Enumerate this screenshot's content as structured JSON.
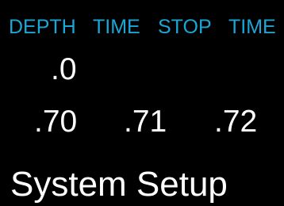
{
  "header": {
    "depth_label": "DEPTH",
    "time_label_1": "TIME",
    "stop_label": "STOP",
    "time_label_2": "TIME"
  },
  "readings": {
    "depth_value": ".0",
    "value_1": ".70",
    "value_2": ".71",
    "value_3": ".72"
  },
  "menu": {
    "current_item": "System Setup"
  },
  "colors": {
    "header_text": "#1aa6d6",
    "value_text": "#ffffff",
    "background": "#000000"
  }
}
